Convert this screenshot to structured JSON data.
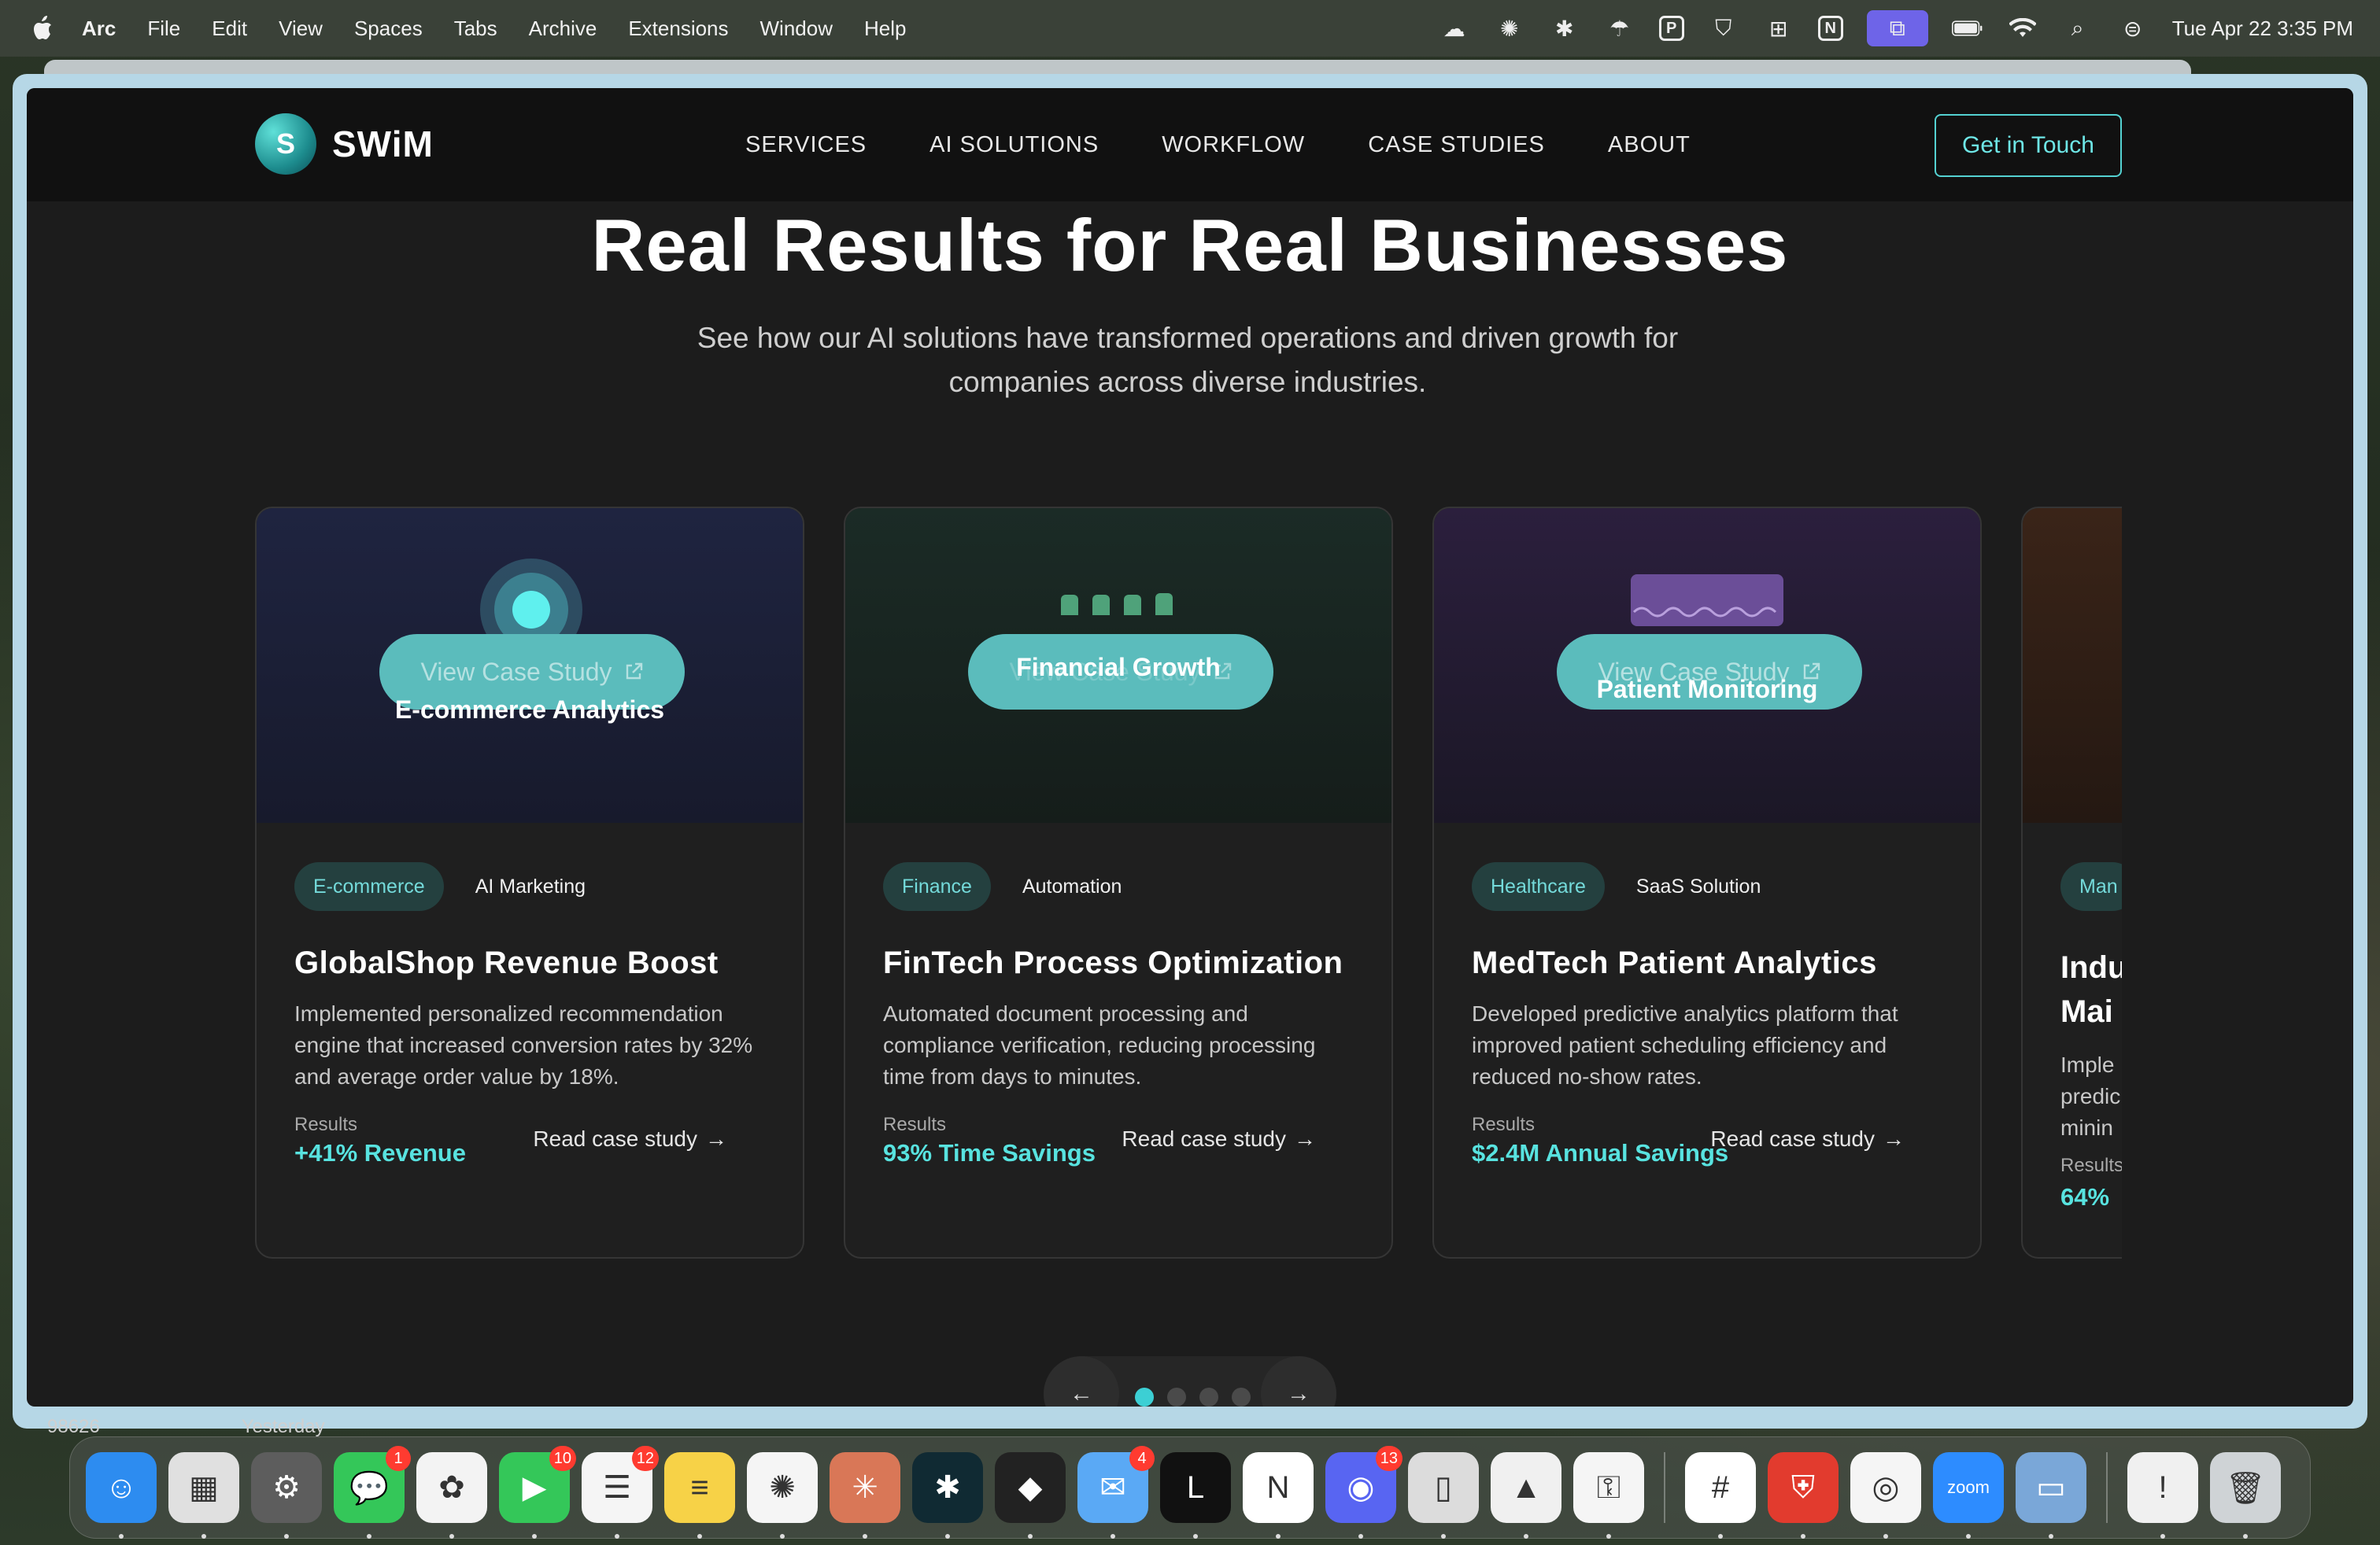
{
  "menubar": {
    "app_name": "Arc",
    "items": [
      "File",
      "Edit",
      "View",
      "Spaces",
      "Tabs",
      "Archive",
      "Extensions",
      "Window",
      "Help"
    ],
    "clock": "Tue Apr 22  3:35 PM",
    "status_icons": [
      "cloud-icon",
      "openai-icon",
      "perplexity-icon",
      "cloud-sync-icon",
      "p-box-icon",
      "shield-icon",
      "grid-dots-icon",
      "notion-icon",
      "screens-icon",
      "battery-icon",
      "wifi-icon",
      "search-icon",
      "control-center-icon"
    ]
  },
  "site": {
    "logo_letter": "S",
    "logo_text": "SWiM",
    "nav": [
      "SERVICES",
      "AI SOLUTIONS",
      "WORKFLOW",
      "CASE STUDIES",
      "ABOUT"
    ],
    "cta": "Get in Touch",
    "accent_color": "#58e3e0"
  },
  "hero": {
    "title": "Real Results for Real Businesses",
    "subtitle": "See how our AI solutions have transformed operations and driven growth for companies across diverse industries."
  },
  "cards": [
    {
      "pill": "View Case Study",
      "caption": "E-commerce Analytics",
      "tag_primary": "E-commerce",
      "tag_secondary": "AI Marketing",
      "title": "GlobalShop Revenue Boost",
      "description": "Implemented personalized recommendation engine that increased conversion rates by 32% and average order value by 18%.",
      "results_label": "Results",
      "results_value": "+41% Revenue",
      "link": "Read case study"
    },
    {
      "pill": "View Case Study",
      "caption": "Financial Growth",
      "tag_primary": "Finance",
      "tag_secondary": "Automation",
      "title": "FinTech Process Optimization",
      "description": "Automated document processing and compliance verification, reducing processing time from days to minutes.",
      "results_label": "Results",
      "results_value": "93% Time Savings",
      "link": "Read case study"
    },
    {
      "pill": "View Case Study",
      "caption": "Patient Monitoring",
      "tag_primary": "Healthcare",
      "tag_secondary": "SaaS Solution",
      "title": "MedTech Patient Analytics",
      "description": "Developed predictive analytics platform that improved patient scheduling efficiency and reduced no-show rates.",
      "results_label": "Results",
      "results_value": "$2.4M Annual Savings",
      "link": "Read case study"
    },
    {
      "tag_primary": "Man",
      "title_line1": "Indu",
      "title_line2": "Mai",
      "desc_line1": "Imple",
      "desc_line2": "predic",
      "desc_line3": "minin",
      "results_label": "Results",
      "results_value": "64%"
    }
  ],
  "carousel": {
    "prev": "←",
    "next": "→",
    "active_index": 0,
    "dot_count": 4
  },
  "under_window": {
    "left_text": "98626",
    "right_text": "Yesterday"
  },
  "dock": {
    "apps": [
      {
        "name": "finder-icon",
        "glyph": "☺",
        "color": "#2d8cf0"
      },
      {
        "name": "launchpad-icon",
        "glyph": "▦",
        "color": "#e0e0e0"
      },
      {
        "name": "system-settings-icon",
        "glyph": "⚙",
        "color": "#5d5d5d"
      },
      {
        "name": "messages-icon",
        "glyph": "💬",
        "color": "#34c759",
        "badge": "1"
      },
      {
        "name": "photos-icon",
        "glyph": "✿",
        "color": "#f3f3f3"
      },
      {
        "name": "facetime-icon",
        "glyph": "▶",
        "color": "#34c759",
        "badge": "10"
      },
      {
        "name": "reminders-icon",
        "glyph": "☰",
        "color": "#f5f5f5",
        "badge": "12"
      },
      {
        "name": "notes-icon",
        "glyph": "≡",
        "color": "#f7d247"
      },
      {
        "name": "chatgpt-icon",
        "glyph": "✺",
        "color": "#f5f5f5"
      },
      {
        "name": "claude-icon",
        "glyph": "✳",
        "color": "#d97757"
      },
      {
        "name": "perplexity-icon",
        "glyph": "✱",
        "color": "#102a33"
      },
      {
        "name": "raycast-icon",
        "glyph": "◆",
        "color": "#222"
      },
      {
        "name": "mail-icon",
        "glyph": "✉",
        "color": "#5aa9f5",
        "badge": "4"
      },
      {
        "name": "linear-icon",
        "glyph": "L",
        "color": "#111"
      },
      {
        "name": "notion-icon",
        "glyph": "N",
        "color": "#fff"
      },
      {
        "name": "discord-icon",
        "glyph": "◉",
        "color": "#5865f2",
        "badge": "13"
      },
      {
        "name": "iphone-mirroring-icon",
        "glyph": "▯",
        "color": "#dcdcdc"
      },
      {
        "name": "affinity-icon",
        "glyph": "▲",
        "color": "#f0f0f0"
      },
      {
        "name": "passwords-icon",
        "glyph": "⚿",
        "color": "#f5f5f5"
      },
      {
        "name": "slack-icon",
        "glyph": "#",
        "color": "#ffffff"
      },
      {
        "name": "bitdefender-icon",
        "glyph": "⛨",
        "color": "#e23b2e"
      },
      {
        "name": "chrome-icon",
        "glyph": "◎",
        "color": "#f5f5f5"
      },
      {
        "name": "zoom-icon",
        "glyph": "zoom",
        "color": "#2d8cff"
      },
      {
        "name": "display-icon",
        "glyph": "▭",
        "color": "#7aa7d8"
      },
      {
        "name": "document-icon",
        "glyph": "!",
        "color": "#f0f0f0"
      },
      {
        "name": "trash-icon",
        "glyph": "🗑",
        "color": "#cfd3d6"
      }
    ]
  }
}
